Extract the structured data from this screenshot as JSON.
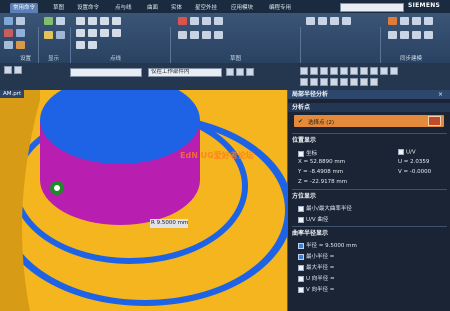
{
  "menu": {
    "tabs": [
      "常用命令",
      "草图",
      "设置命令",
      "点与线",
      "曲面",
      "实体",
      "星空外挂",
      "应用模块",
      "编程专用"
    ],
    "active_tab": "常用命令",
    "search_placeholder": "",
    "brand": "SIEMENS"
  },
  "ribbon": {
    "groups": [
      "设置",
      "显示",
      "点线",
      "草图",
      "同步建模"
    ]
  },
  "toolbar": {
    "filter_value": "",
    "scope_value": "仅在工作部件内"
  },
  "viewport": {
    "file_tab": "AM.prt",
    "tooltip_value": "R 9.5000 mm",
    "watermark": "EdN UG爱好者论坛",
    "colors": {
      "body": "#f5b51e",
      "edge": "#1e63e6",
      "top": "#1e63e6",
      "cylinder": "#b81fb0",
      "point": "#1f8a2a"
    }
  },
  "panel": {
    "title": "局部半径分析",
    "section_analysis": "分析点",
    "select_point_label": "选择点 (2)",
    "section_position": "位置显示",
    "coord_label": "坐标",
    "uv_label": "U/V",
    "x_label": "X = 52.8890 mm",
    "y_label": "Y = -8.4908 mm",
    "z_label": "Z = -22.9178 mm",
    "u_label": "U = 2.0359",
    "v_label": "V = -0.0000",
    "section_direction": "方位显示",
    "dir_opt1": "最小/最大曲率半径",
    "dir_opt2": "U/V 曲径",
    "section_radius": "曲率半径显示",
    "radius_label": "半径 = 9.5000 mm",
    "min_radius": "最小半径 =",
    "max_radius": "最大半径 =",
    "u_radius": "U 向半径 =",
    "v_radius": "V 向半径 ="
  }
}
